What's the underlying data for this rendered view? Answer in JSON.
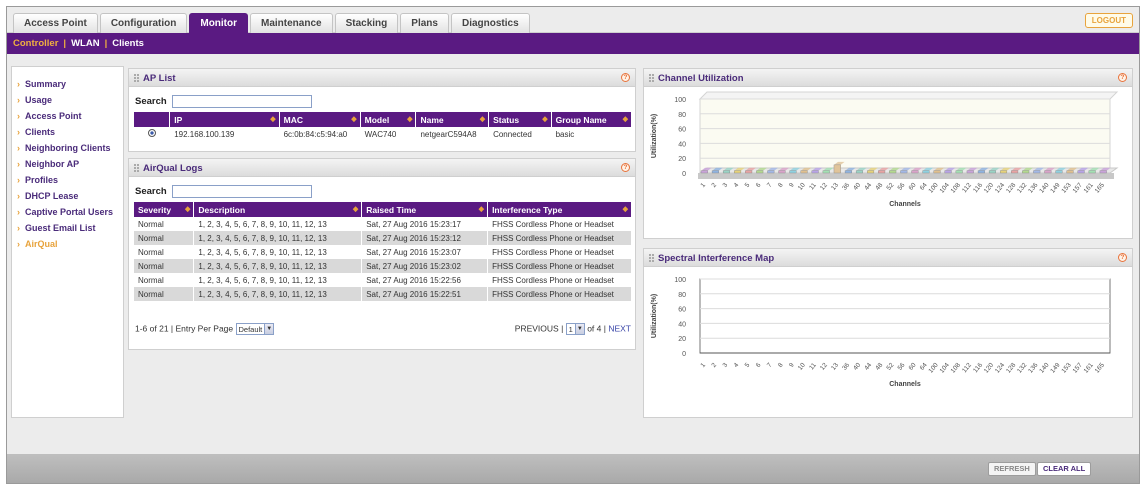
{
  "tabs": [
    "Access Point",
    "Configuration",
    "Monitor",
    "Maintenance",
    "Stacking",
    "Plans",
    "Diagnostics"
  ],
  "logout": "LOGOUT",
  "subnav": [
    "Controller",
    "WLAN",
    "Clients"
  ],
  "sidebar": [
    "Summary",
    "Usage",
    "Access Point",
    "Clients",
    "Neighboring Clients",
    "Neighbor AP",
    "Profiles",
    "DHCP Lease",
    "Captive Portal Users",
    "Guest Email List",
    "AirQual"
  ],
  "ap_list": {
    "title": "AP List",
    "search_label": "Search",
    "columns": [
      "IP",
      "MAC",
      "Model",
      "Name",
      "Status",
      "Group Name"
    ],
    "rows": [
      [
        "192.168.100.139",
        "6c:0b:84:c5:94:a0",
        "WAC740",
        "netgearC594A8",
        "Connected",
        "basic"
      ]
    ]
  },
  "airqual": {
    "title": "AirQual Logs",
    "search_label": "Search",
    "columns": [
      "Severity",
      "Description",
      "Raised Time",
      "Interference Type"
    ],
    "rows": [
      [
        "Normal",
        "1, 2, 3, 4, 5, 6, 7, 8, 9, 10, 11, 12, 13",
        "Sat, 27 Aug 2016 15:23:17",
        "FHSS Cordless Phone or Headset"
      ],
      [
        "Normal",
        "1, 2, 3, 4, 5, 6, 7, 8, 9, 10, 11, 12, 13",
        "Sat, 27 Aug 2016 15:23:12",
        "FHSS Cordless Phone or Headset"
      ],
      [
        "Normal",
        "1, 2, 3, 4, 5, 6, 7, 8, 9, 10, 11, 12, 13",
        "Sat, 27 Aug 2016 15:23:07",
        "FHSS Cordless Phone or Headset"
      ],
      [
        "Normal",
        "1, 2, 3, 4, 5, 6, 7, 8, 9, 10, 11, 12, 13",
        "Sat, 27 Aug 2016 15:23:02",
        "FHSS Cordless Phone or Headset"
      ],
      [
        "Normal",
        "1, 2, 3, 4, 5, 6, 7, 8, 9, 10, 11, 12, 13",
        "Sat, 27 Aug 2016 15:22:56",
        "FHSS Cordless Phone or Headset"
      ],
      [
        "Normal",
        "1, 2, 3, 4, 5, 6, 7, 8, 9, 10, 11, 12, 13",
        "Sat, 27 Aug 2016 15:22:51",
        "FHSS Cordless Phone or Headset"
      ]
    ],
    "range_text": "1-6 of 21 | Entry Per Page",
    "per_page": "Default",
    "previous": "PREVIOUS |",
    "page": "1",
    "of_pages": "of 4 |",
    "next": "NEXT"
  },
  "channel_util": {
    "title": "Channel Utilization"
  },
  "spectral": {
    "title": "Spectral Interference Map"
  },
  "buttons": {
    "refresh": "REFRESH",
    "clear_all": "CLEAR ALL"
  },
  "chart_data": [
    {
      "type": "bar",
      "title": "Channel Utilization",
      "xlabel": "Channels",
      "ylabel": "Utilization(%)",
      "ylim": [
        0,
        100
      ],
      "yticks": [
        0,
        20,
        40,
        60,
        80,
        100
      ],
      "grid": true,
      "categories": [
        "1",
        "2",
        "3",
        "4",
        "5",
        "6",
        "7",
        "8",
        "9",
        "10",
        "11",
        "12",
        "13",
        "36",
        "40",
        "44",
        "48",
        "52",
        "56",
        "60",
        "64",
        "100",
        "104",
        "108",
        "112",
        "116",
        "120",
        "124",
        "128",
        "132",
        "136",
        "140",
        "149",
        "153",
        "157",
        "161",
        "165"
      ],
      "values": [
        3,
        3,
        3,
        3,
        3,
        3,
        3,
        3,
        3,
        3,
        3,
        3,
        11,
        3,
        3,
        3,
        3,
        3,
        3,
        3,
        3,
        3,
        3,
        3,
        3,
        3,
        3,
        3,
        3,
        3,
        3,
        3,
        3,
        3,
        3,
        3,
        3
      ]
    },
    {
      "type": "line",
      "title": "Spectral Interference Map",
      "xlabel": "Channels",
      "ylabel": "Utilization(%)",
      "ylim": [
        0,
        100
      ],
      "yticks": [
        0,
        20,
        40,
        60,
        80,
        100
      ],
      "grid": true,
      "categories": [
        "1",
        "2",
        "3",
        "4",
        "5",
        "6",
        "7",
        "8",
        "9",
        "10",
        "11",
        "12",
        "13",
        "36",
        "40",
        "44",
        "48",
        "52",
        "56",
        "60",
        "64",
        "100",
        "104",
        "108",
        "112",
        "116",
        "120",
        "124",
        "128",
        "132",
        "136",
        "140",
        "149",
        "153",
        "157",
        "161",
        "165"
      ],
      "series": []
    }
  ]
}
